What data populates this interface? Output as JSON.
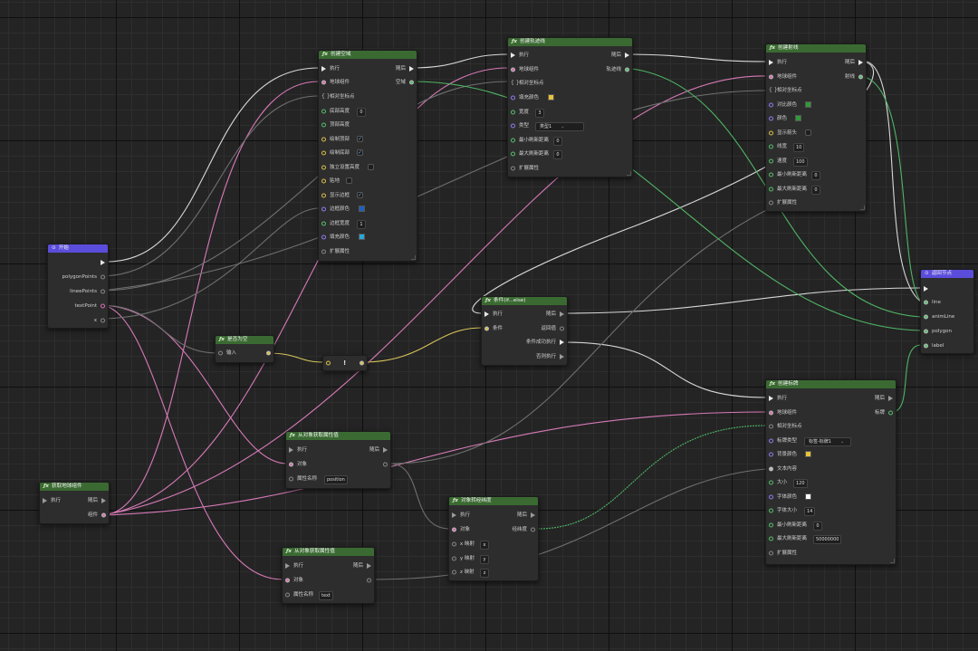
{
  "colors": {
    "header_green": "#3a6a32",
    "header_purple": "#5b4ddb",
    "wire_white": "#d8d8d8",
    "wire_pink": "#d77ab8",
    "wire_green": "#4fb565",
    "wire_yellow": "#d6c45a",
    "wire_gray": "#6f6f6f"
  },
  "start": {
    "title": "开始",
    "icon": "play-circle-icon",
    "pins": [
      "polygonPoints",
      "lineePoints",
      "textPoint",
      "x"
    ]
  },
  "create_area": {
    "title": "创建空域",
    "exec_in": "执行",
    "exec_out": "随后",
    "globe_in": "地球组件",
    "globe_out": "空域",
    "ext_points": "相对坐标点",
    "base_height_label": "底部高度",
    "base_height_value": "0",
    "top_height_label": "顶部高度",
    "draw_top_label": "绘制顶部",
    "draw_bottom_label": "绘制底部",
    "independent_label": "独立设置高度",
    "clamp_label": "贴地",
    "show_border_label": "显示边框",
    "border_color_label": "边框颜色",
    "border_width_label": "边框宽度",
    "border_width_value": "1",
    "fill_color_label": "填充颜色",
    "extend_label": "扩展属性"
  },
  "create_track": {
    "title": "创建轨迹线",
    "exec_in": "执行",
    "exec_out": "随后",
    "globe_in": "地球组件",
    "out": "轨迹线",
    "points": "相对坐标点",
    "fill_color_label": "填充颜色",
    "width_label": "宽度",
    "width_value": "3",
    "type_label": "类型",
    "type_value": "类型1",
    "min_dist_label": "最小刷新距离",
    "min_dist_value": "0",
    "max_dist_label": "最大刷新距离",
    "max_dist_value": "0",
    "extend_label": "扩展属性"
  },
  "create_line": {
    "title": "创建射线",
    "exec_in": "执行",
    "exec_out": "随后",
    "globe_in": "地球组件",
    "out": "射线",
    "points": "相对坐标点",
    "contrast_label": "对比颜色",
    "color_label": "颜色",
    "show_label": "显示箭头",
    "line_width_label": "线宽",
    "line_width_value": "10",
    "speed_label": "速度",
    "speed_value": "100",
    "min_dist_label": "最小刷新距离",
    "min_dist_value": "0",
    "max_dist_label": "最大刷新距离",
    "max_dist_value": "0",
    "extend_label": "扩展属性"
  },
  "return_node": {
    "title": "返回节点",
    "pins": [
      "line",
      "animLine",
      "polygon",
      "label"
    ]
  },
  "is_empty": {
    "title": "是否为空",
    "input_label": "输入"
  },
  "not_node": {
    "label": "!"
  },
  "condition": {
    "title": "条件(if...else)",
    "exec_in": "执行",
    "exec_out": "随后",
    "cond_in": "条件",
    "cond_out": "返回值",
    "true_out": "条件成功执行",
    "false_out": "否则执行"
  },
  "create_label": {
    "title": "创建标牌",
    "exec_in": "执行",
    "exec_out": "随后",
    "globe_in": "地球组件",
    "out": "标牌",
    "points": "相对坐标点",
    "type_label": "标牌类型",
    "type_value": "标签-标牌1",
    "bg_color_label": "背景颜色",
    "text_label": "文本内容",
    "size_label": "大小",
    "size_value": "120",
    "font_color_label": "字体颜色",
    "font_size_label": "字体大小",
    "font_size_value": "14",
    "min_dist_label": "最小刷新距离",
    "min_dist_value": "0",
    "max_dist_label": "最大刷新距离",
    "max_dist_value": "50000000",
    "extend_label": "扩展属性"
  },
  "get_prop_1": {
    "title": "从对象获取属性值",
    "exec_in": "执行",
    "exec_out": "随后",
    "obj_label": "对象",
    "prop_label": "属性名称",
    "prop_value": "position"
  },
  "get_globe": {
    "title": "获取地球组件",
    "exec_in": "执行",
    "exec_out": "随后",
    "out": "组件"
  },
  "obj_to_coord": {
    "title": "对象转经纬度",
    "exec_in": "执行",
    "exec_out": "随后",
    "obj_label": "对象",
    "out": "经纬度",
    "x_label": "x 映射",
    "x_value": "x",
    "y_label": "y 映射",
    "y_value": "y",
    "z_label": "z 映射",
    "z_value": "z"
  },
  "get_prop_2": {
    "title": "从对象获取属性值",
    "exec_in": "执行",
    "exec_out": "随后",
    "obj_label": "对象",
    "prop_label": "属性名称",
    "prop_value": "text"
  }
}
